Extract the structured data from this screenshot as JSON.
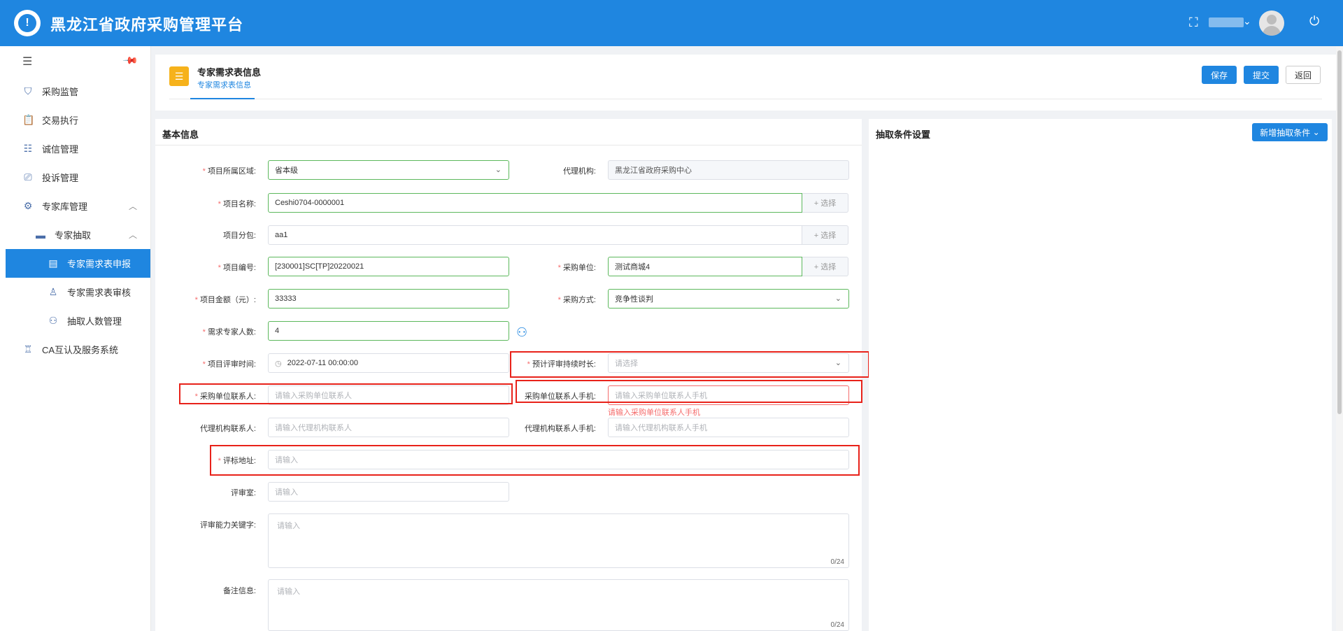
{
  "header": {
    "app_title": "黑龙江省政府采购管理平台",
    "logo_glyph": "!",
    "expand_icon": "⛶",
    "caret": "⌄",
    "power_icon": "⏻"
  },
  "sidebar": {
    "items": [
      {
        "label": "采购监管",
        "icon": "shield-icon"
      },
      {
        "label": "交易执行",
        "icon": "clipboard-icon"
      },
      {
        "label": "诚信管理",
        "icon": "list-icon"
      },
      {
        "label": "投诉管理",
        "icon": "complaint-icon"
      },
      {
        "label": "专家库管理",
        "icon": "gear-icon"
      },
      {
        "label": "专家抽取",
        "icon": "monitor-icon"
      },
      {
        "label": "专家需求表申报",
        "icon": "form-icon"
      },
      {
        "label": "专家需求表审核",
        "icon": "person-icon"
      },
      {
        "label": "抽取人数管理",
        "icon": "people-icon"
      },
      {
        "label": "CA互认及服务系统",
        "icon": "ca-icon"
      }
    ]
  },
  "title_card": {
    "title": "专家需求表信息",
    "subtitle": "专家需求表信息",
    "save": "保存",
    "submit": "提交",
    "back": "返回"
  },
  "basic": {
    "section_title": "基本信息",
    "region_label": "项目所属区域:",
    "region_value": "省本级",
    "agency_label": "代理机构:",
    "agency_value": "黑龙江省政府采购中心",
    "project_name_label": "项目名称:",
    "project_name_value": "Ceshi0704-0000001",
    "select_btn": "+ 选择",
    "package_label": "项目分包:",
    "package_value": "aa1",
    "project_no_label": "项目编号:",
    "project_no_value": "[230001]SC[TP]20220021",
    "purchaser_label": "采购单位:",
    "purchaser_value": "测试商城4",
    "amount_label": "项目金额（元）:",
    "amount_value": "33333",
    "method_label": "采购方式:",
    "method_value": "竞争性谈判",
    "experts_label": "需求专家人数:",
    "experts_value": "4",
    "review_time_label": "项目评审时间:",
    "review_time_value": "2022-07-11 00:00:00",
    "duration_label": "预计评审持续时长:",
    "duration_placeholder": "请选择",
    "contact_label": "采购单位联系人:",
    "contact_placeholder": "请输入采购单位联系人",
    "contact_phone_label": "采购单位联系人手机:",
    "contact_phone_placeholder": "请输入采购单位联系人手机",
    "contact_phone_error": "请输入采购单位联系人手机",
    "agency_contact_label": "代理机构联系人:",
    "agency_contact_placeholder": "请输入代理机构联系人",
    "agency_phone_label": "代理机构联系人手机:",
    "agency_phone_placeholder": "请输入代理机构联系人手机",
    "address_label": "评标地址:",
    "address_placeholder": "请输入",
    "room_label": "评审室:",
    "room_placeholder": "请输入",
    "keywords_label": "评审能力关键字:",
    "keywords_placeholder": "请输入",
    "keywords_count": "0/24",
    "remarks_label": "备注信息:",
    "remarks_placeholder": "请输入",
    "remarks_count": "0/24"
  },
  "conditions": {
    "section_title": "抽取条件设置",
    "add_button": "新增抽取条件"
  },
  "colors": {
    "brand": "#1f86e0",
    "error": "#f56c6c",
    "highlight": "#e8221a",
    "ok_border": "#5cb85c"
  }
}
